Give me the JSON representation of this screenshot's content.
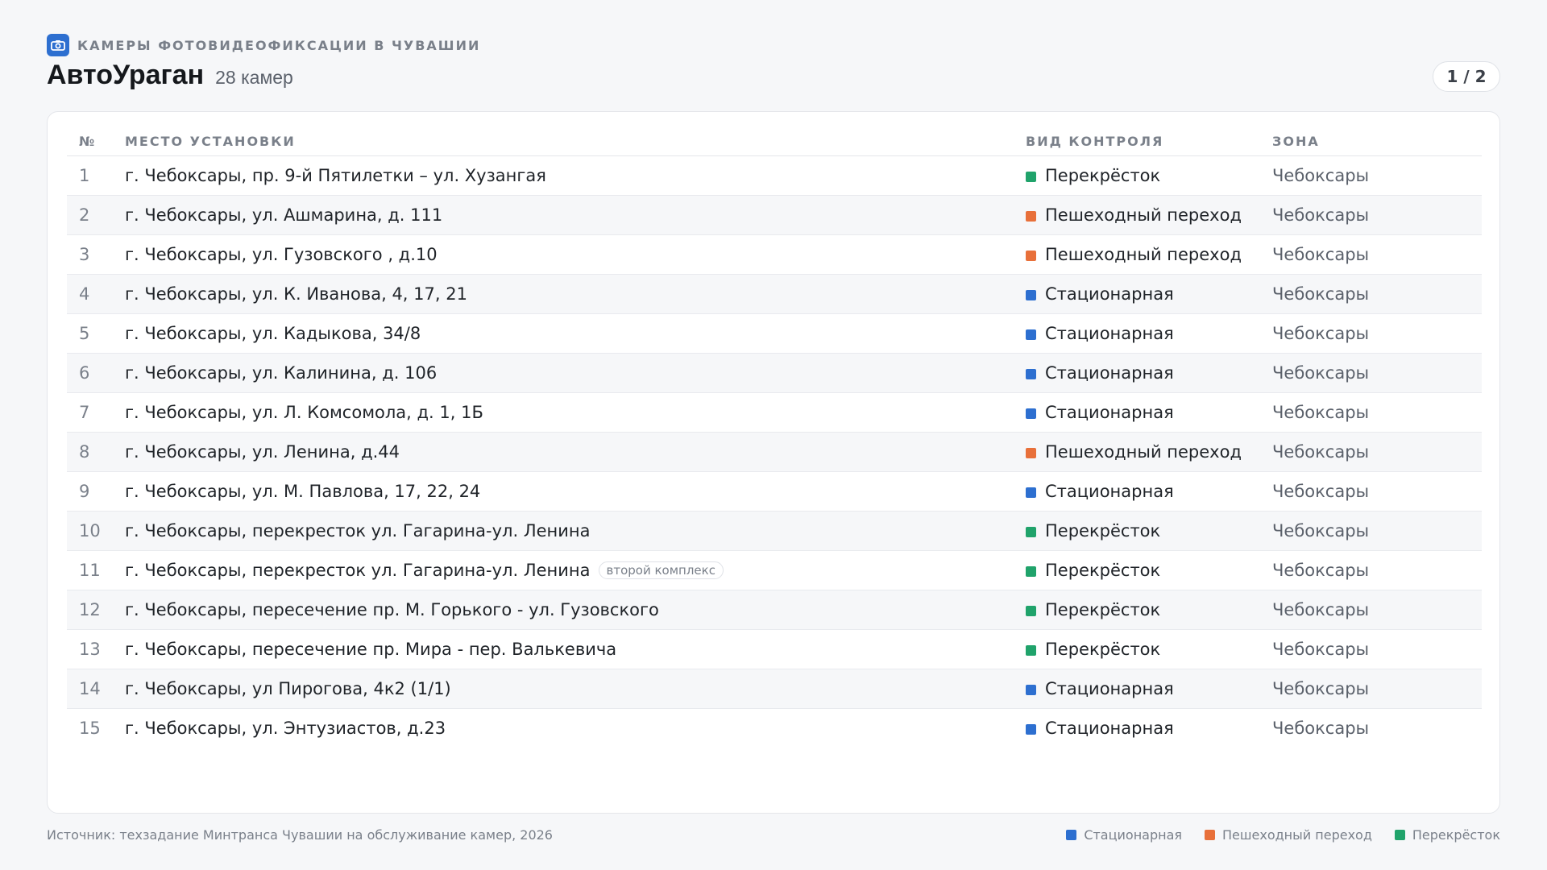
{
  "header": {
    "kicker": "КАМЕРЫ ФОТОВИДЕОФИКСАЦИИ В ЧУВАШИИ",
    "title": "АвтоУраган",
    "subtitle": "28 камер",
    "pager": "1 / 2"
  },
  "table": {
    "columns": [
      "№",
      "МЕСТО УСТАНОВКИ",
      "ВИД КОНТРОЛЯ",
      "ЗОНА"
    ],
    "rows": [
      {
        "num": "1",
        "place": "г. Чебоксары, пр. 9-й Пятилетки – ул. Хузангая",
        "tag": "",
        "type": "Перекрёсток",
        "zone": "Чебоксары"
      },
      {
        "num": "2",
        "place": "г. Чебоксары, ул. Ашмарина, д. 111",
        "tag": "",
        "type": "Пешеходный переход",
        "zone": "Чебоксары"
      },
      {
        "num": "3",
        "place": "г. Чебоксары, ул. Гузовского , д.10",
        "tag": "",
        "type": "Пешеходный переход",
        "zone": "Чебоксары"
      },
      {
        "num": "4",
        "place": "г. Чебоксары, ул. К. Иванова, 4, 17, 21",
        "tag": "",
        "type": "Стационарная",
        "zone": "Чебоксары"
      },
      {
        "num": "5",
        "place": "г. Чебоксары, ул. Кадыкова, 34/8",
        "tag": "",
        "type": "Стационарная",
        "zone": "Чебоксары"
      },
      {
        "num": "6",
        "place": "г. Чебоксары, ул. Калинина, д. 106",
        "tag": "",
        "type": "Стационарная",
        "zone": "Чебоксары"
      },
      {
        "num": "7",
        "place": "г. Чебоксары, ул. Л. Комсомола, д. 1, 1Б",
        "tag": "",
        "type": "Стационарная",
        "zone": "Чебоксары"
      },
      {
        "num": "8",
        "place": "г. Чебоксары, ул. Ленина, д.44",
        "tag": "",
        "type": "Пешеходный переход",
        "zone": "Чебоксары"
      },
      {
        "num": "9",
        "place": "г. Чебоксары, ул. М. Павлова, 17, 22, 24",
        "tag": "",
        "type": "Стационарная",
        "zone": "Чебоксары"
      },
      {
        "num": "10",
        "place": "г. Чебоксары, перекресток ул. Гагарина-ул. Ленина",
        "tag": "",
        "type": "Перекрёсток",
        "zone": "Чебоксары"
      },
      {
        "num": "11",
        "place": "г. Чебоксары, перекресток ул. Гагарина-ул. Ленина",
        "tag": "второй комплекс",
        "type": "Перекрёсток",
        "zone": "Чебоксары"
      },
      {
        "num": "12",
        "place": "г. Чебоксары, пересечение пр. М. Горького - ул. Гузовского",
        "tag": "",
        "type": "Перекрёсток",
        "zone": "Чебоксары"
      },
      {
        "num": "13",
        "place": "г. Чебоксары, пересечение пр. Мира - пер. Валькевича",
        "tag": "",
        "type": "Перекрёсток",
        "zone": "Чебоксары"
      },
      {
        "num": "14",
        "place": "г. Чебоксары, ул Пирогова, 4к2 (1/1)",
        "tag": "",
        "type": "Стационарная",
        "zone": "Чебоксары"
      },
      {
        "num": "15",
        "place": "г. Чебоксары, ул. Энтузиастов, д.23",
        "tag": "",
        "type": "Стационарная",
        "zone": "Чебоксары"
      }
    ]
  },
  "type_colors": {
    "Стационарная": "#2d6fd0",
    "Пешеходный переход": "#e8703a",
    "Перекрёсток": "#20a36b"
  },
  "footer": {
    "source": "Источник: техзадание Минтранса Чувашии на обслуживание камер, 2026",
    "legend": [
      {
        "label": "Стационарная",
        "color": "#2d6fd0"
      },
      {
        "label": "Пешеходный переход",
        "color": "#e8703a"
      },
      {
        "label": "Перекрёсток",
        "color": "#20a36b"
      }
    ]
  },
  "icons": {
    "kicker": "camera-icon"
  }
}
